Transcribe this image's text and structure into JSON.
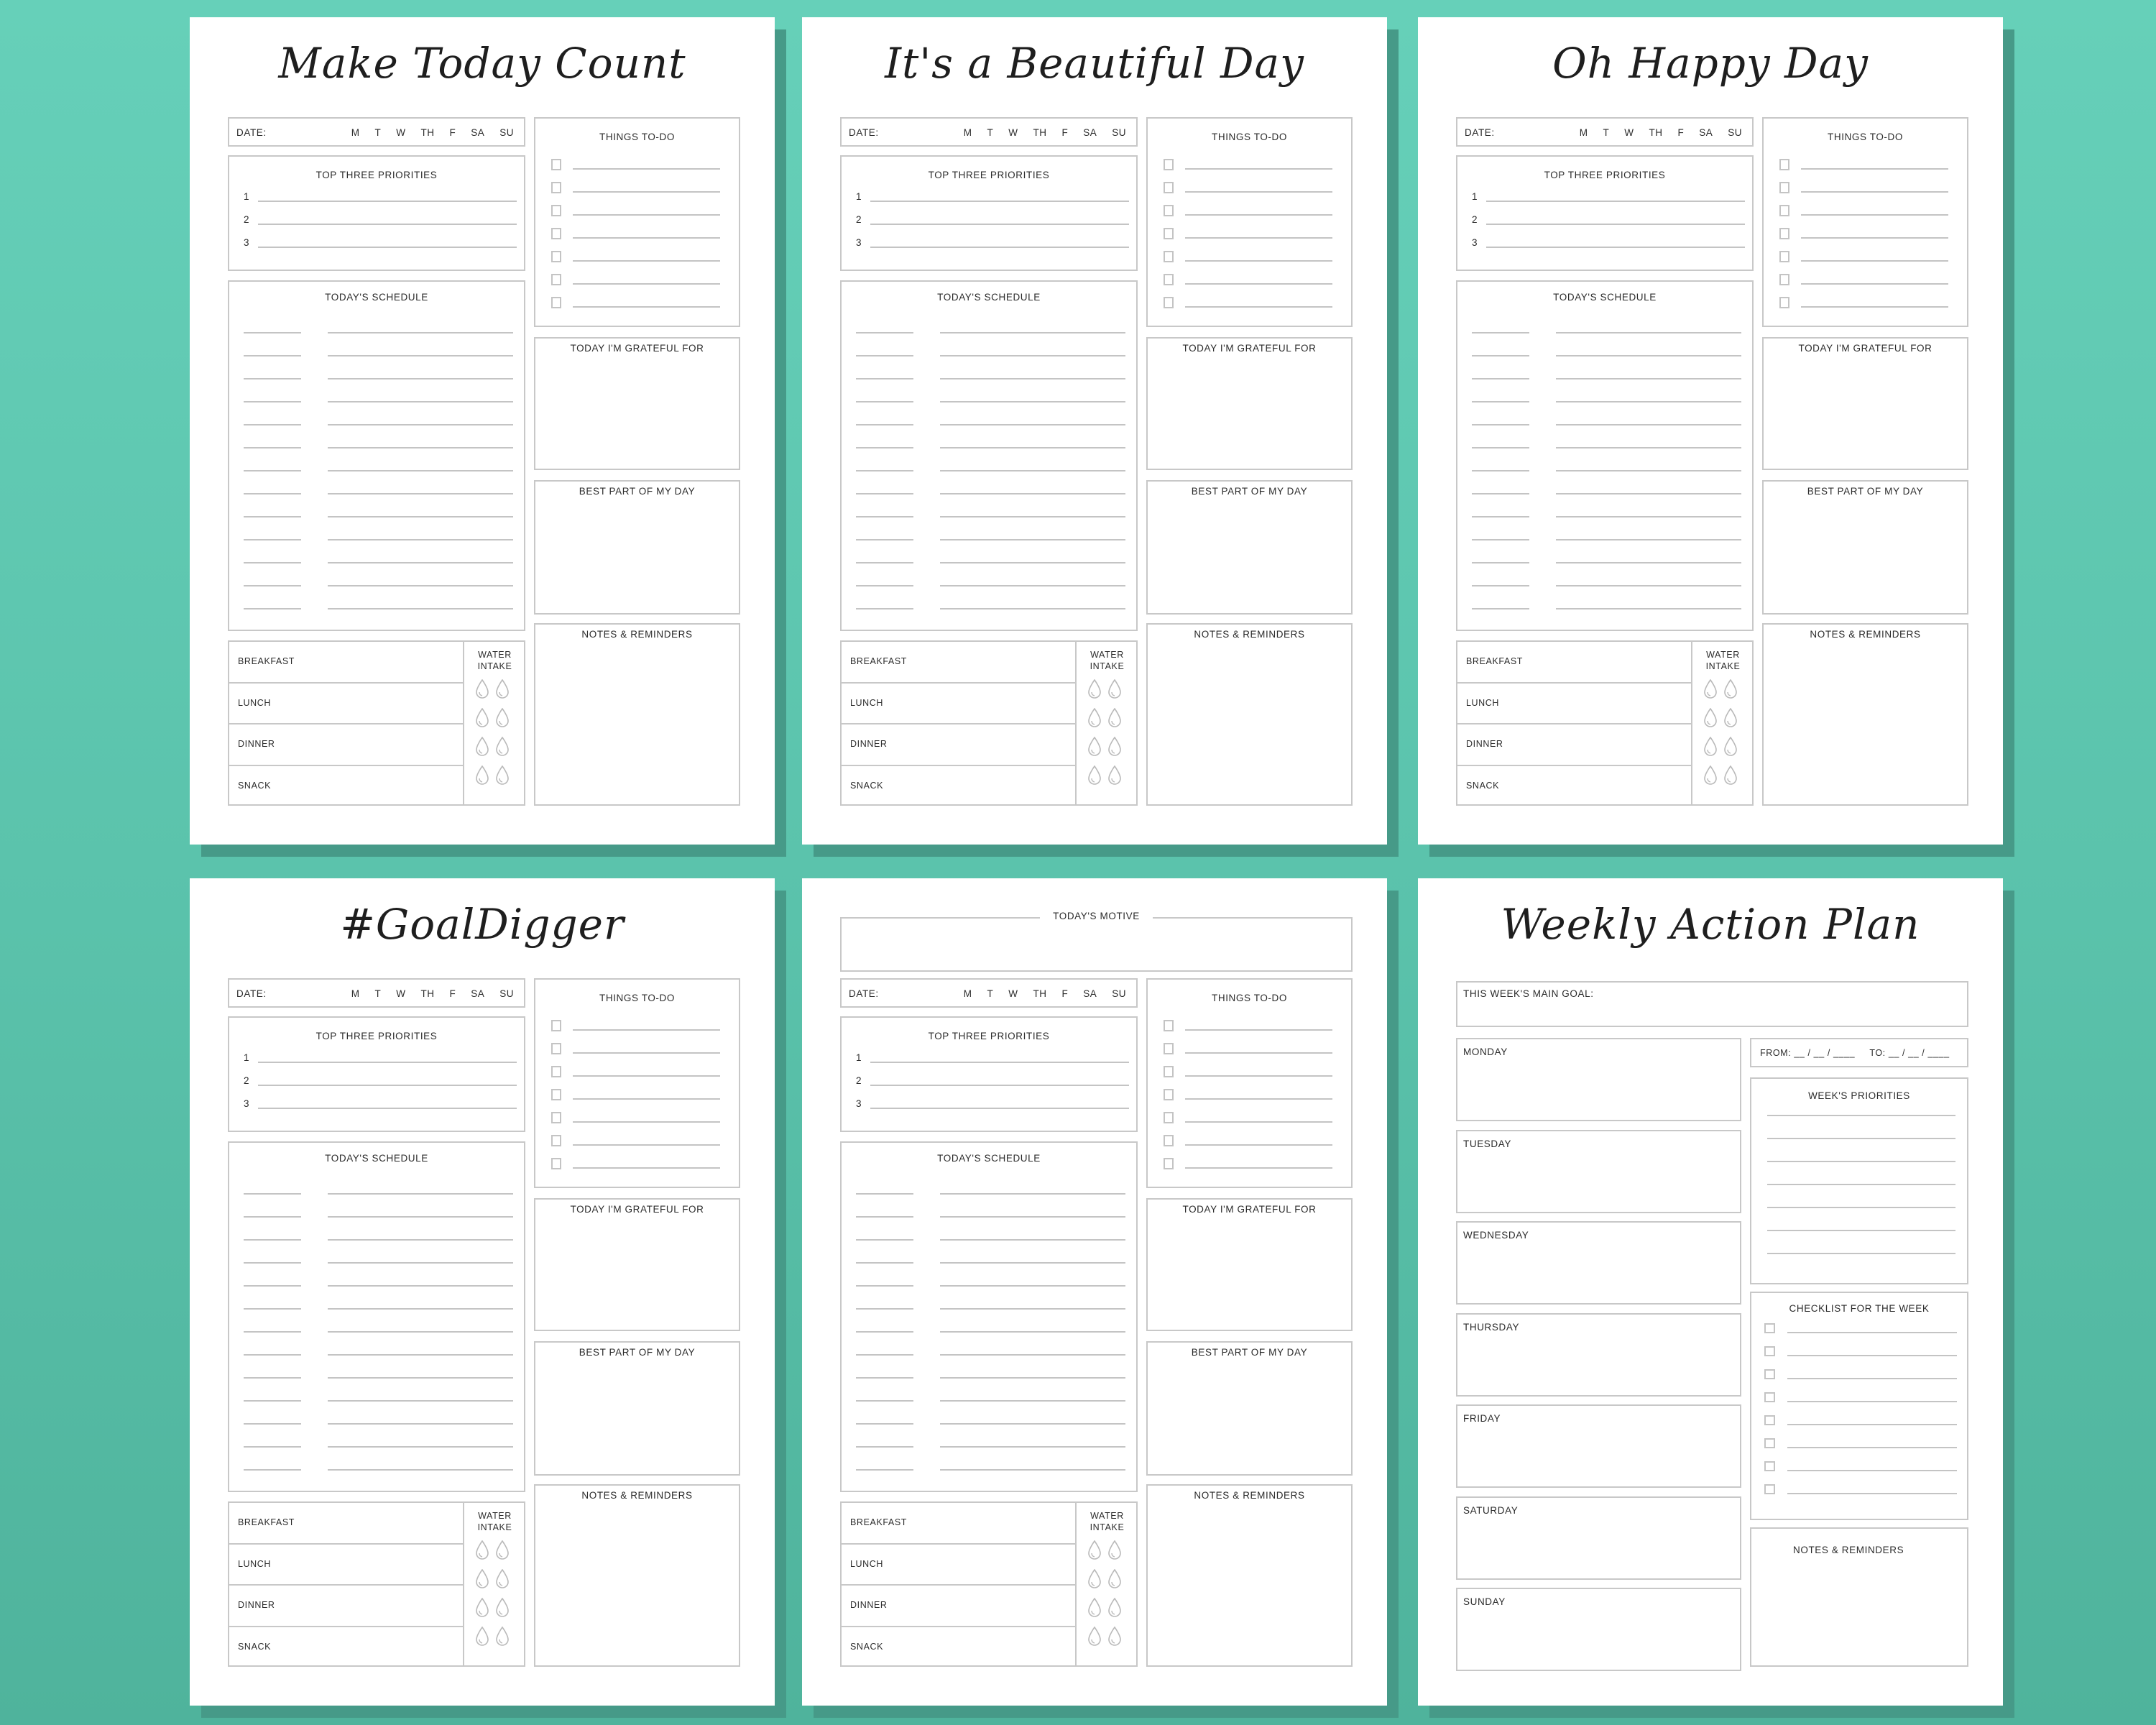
{
  "background_color": "#5fc8b1",
  "shadow_color": "#469a88",
  "line_color": "#c4c4c4",
  "daily_pages": [
    {
      "id": "make-today-count",
      "title": "Make Today Count",
      "motive": null
    },
    {
      "id": "beautiful-day",
      "title": "It's a Beautiful Day",
      "motive": null
    },
    {
      "id": "happy-day",
      "title": "Oh Happy Day",
      "motive": null
    },
    {
      "id": "goal-digger",
      "title": "#GoalDigger",
      "motive": null
    },
    {
      "id": "todays-motive",
      "title": null,
      "motive": "TODAY'S MOTIVE"
    }
  ],
  "daily_template": {
    "date_label": "DATE:",
    "weekdays": [
      "M",
      "T",
      "W",
      "TH",
      "F",
      "SA",
      "SU"
    ],
    "priorities_title": "TOP THREE PRIORITIES",
    "priority_numbers": [
      "1",
      "2",
      "3"
    ],
    "schedule_title": "TODAY'S SCHEDULE",
    "schedule_rows": 13,
    "todo_title": "THINGS TO-DO",
    "todo_items": 7,
    "grateful_title": "TODAY I'M GRATEFUL FOR",
    "best_part_title": "BEST PART OF MY DAY",
    "notes_title": "NOTES & REMINDERS",
    "meals": [
      "BREAKFAST",
      "LUNCH",
      "DINNER",
      "SNACK"
    ],
    "water_title_line1": "WATER",
    "water_title_line2": "INTAKE",
    "water_drops": 8,
    "water_icon": "water-drop-icon"
  },
  "weekly_page": {
    "title": "Weekly Action Plan",
    "main_goal_label": "THIS WEEK'S MAIN GOAL:",
    "days": [
      "MONDAY",
      "TUESDAY",
      "WEDNESDAY",
      "THURSDAY",
      "FRIDAY",
      "SATURDAY",
      "SUNDAY"
    ],
    "from_to_label": "FROM: __ / __ / ____     TO: __ / __ / ____",
    "priorities_title": "WEEK'S PRIORITIES",
    "priority_lines": 7,
    "checklist_title": "CHECKLIST FOR THE WEEK",
    "checklist_items": 8,
    "notes_title": "NOTES & REMINDERS"
  }
}
